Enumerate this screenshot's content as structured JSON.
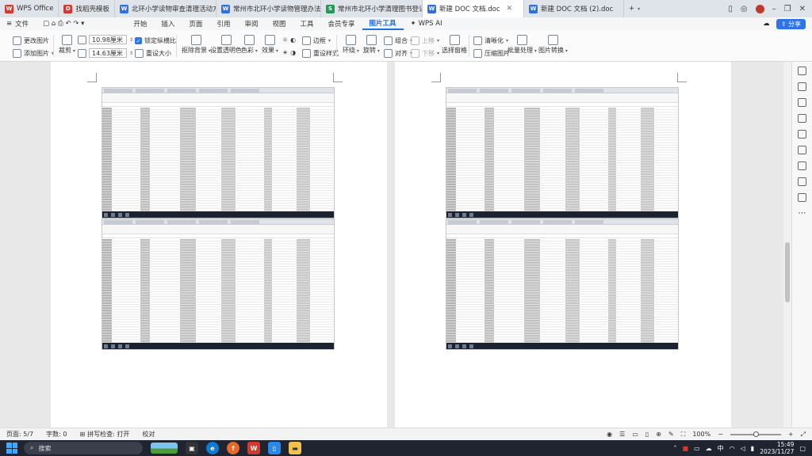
{
  "tabs": [
    {
      "label": "WPS Office",
      "icon": "wps-logo-icon",
      "color": "#d23a2f"
    },
    {
      "label": "找稻壳模板",
      "icon": "docer-icon",
      "color": "#d23a2f"
    },
    {
      "label": "北环小学读物审查清理活动方案202",
      "icon": "word-doc-icon",
      "color": "#2f6fe0"
    },
    {
      "label": "常州市北环小学读物管理办法.doc",
      "icon": "word-doc-icon",
      "color": "#2f6fe0"
    },
    {
      "label": "常州市北环小学清理图书登记表20",
      "icon": "sheet-icon",
      "color": "#1b9b53"
    },
    {
      "label": "新建 DOC 文档.doc",
      "icon": "word-doc-icon",
      "color": "#2f6fe0",
      "active": true
    },
    {
      "label": "新建 DOC 文档 (2).doc",
      "icon": "word-doc-icon",
      "color": "#2f6fe0"
    }
  ],
  "menu": {
    "file": "文件",
    "items": [
      "开始",
      "插入",
      "页面",
      "引用",
      "审阅",
      "视图",
      "工具",
      "会员专享",
      "图片工具"
    ],
    "active": "图片工具",
    "ai": "WPS AI",
    "share": "分享"
  },
  "ribbon": {
    "change_picture": "更改图片",
    "add_picture": "添加图片",
    "crop": "裁剪",
    "width": "10.98厘米",
    "height": "14.63厘米",
    "lock_ratio": "锁定纵横比",
    "reset_size": "重设大小",
    "remove_bg": "抠除背景",
    "set_transparent": "设置透明色",
    "color": "色彩",
    "effects": "效果",
    "border": "边框",
    "reset_style": "重设样式",
    "wrap": "环绕",
    "rotate": "旋转",
    "group": "组合",
    "align": "对齐",
    "bring_forward": "上移",
    "send_backward": "下移",
    "selection_pane": "选择窗格",
    "sharpen": "清晰化",
    "compress": "压缩图片",
    "batch": "批量处理",
    "convert": "图片转换"
  },
  "status": {
    "page": "页面: 5/7",
    "words": "字数: 0",
    "spell": "拼写检查: 打开",
    "proof": "校对",
    "zoom": "100%",
    "zoom_level": 0.5
  },
  "taskbar": {
    "search": "搜索",
    "time": "15:49",
    "date": "2023/11/27"
  }
}
